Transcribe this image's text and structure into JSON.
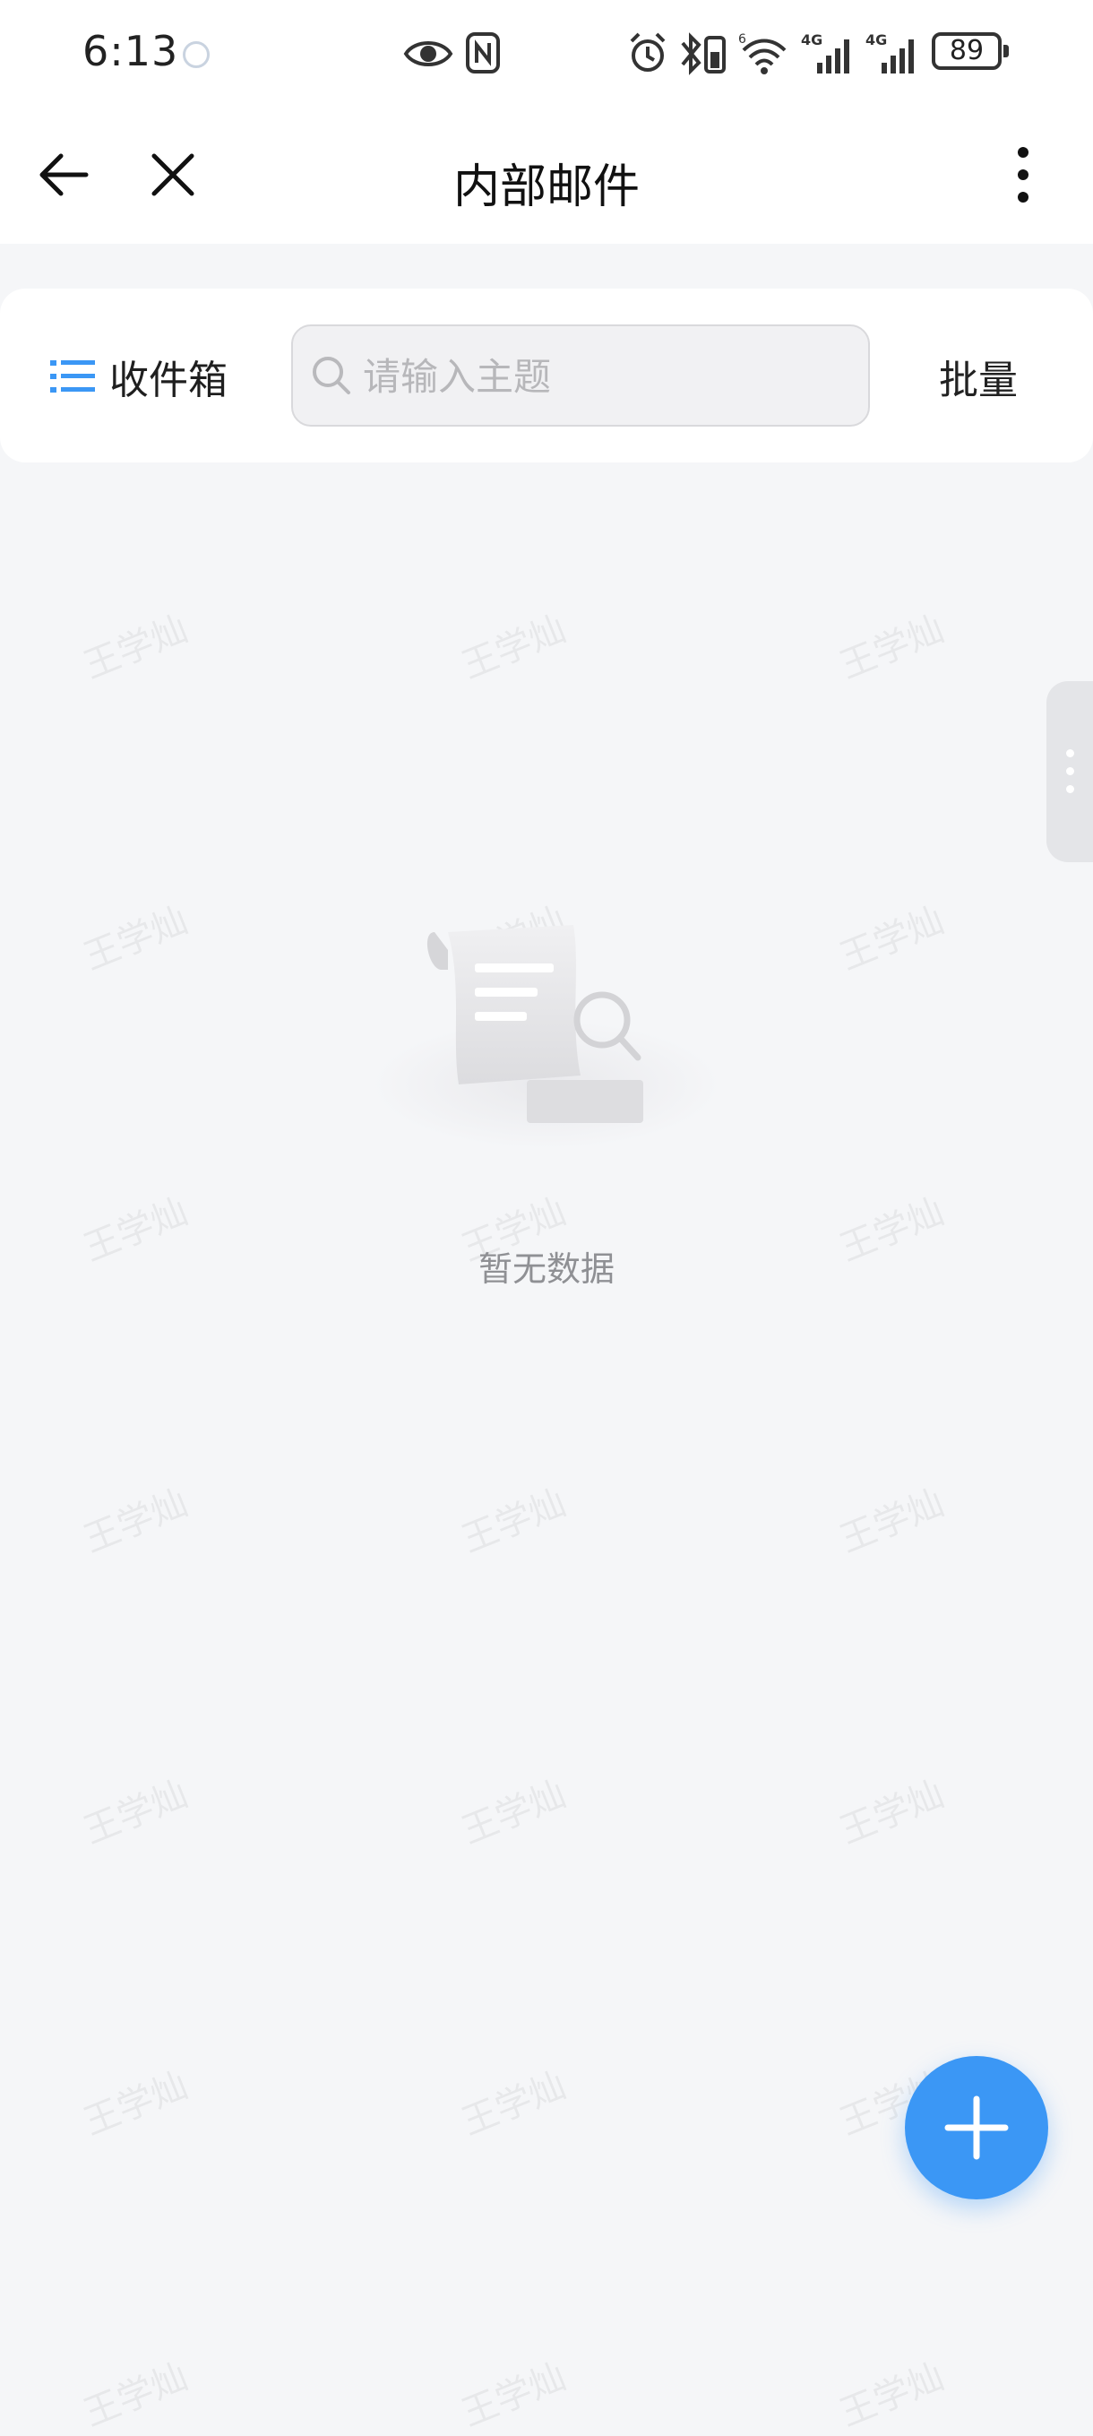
{
  "status_bar": {
    "time": "6:13",
    "battery": "89"
  },
  "nav": {
    "title": "内部邮件"
  },
  "toolbar": {
    "folder_label": "收件箱",
    "search_placeholder": "请输入主题",
    "batch_label": "批量"
  },
  "empty": {
    "text": "暂无数据"
  },
  "watermark": "王学灿",
  "colors": {
    "accent": "#3b97f5",
    "background": "#f5f6f8"
  }
}
